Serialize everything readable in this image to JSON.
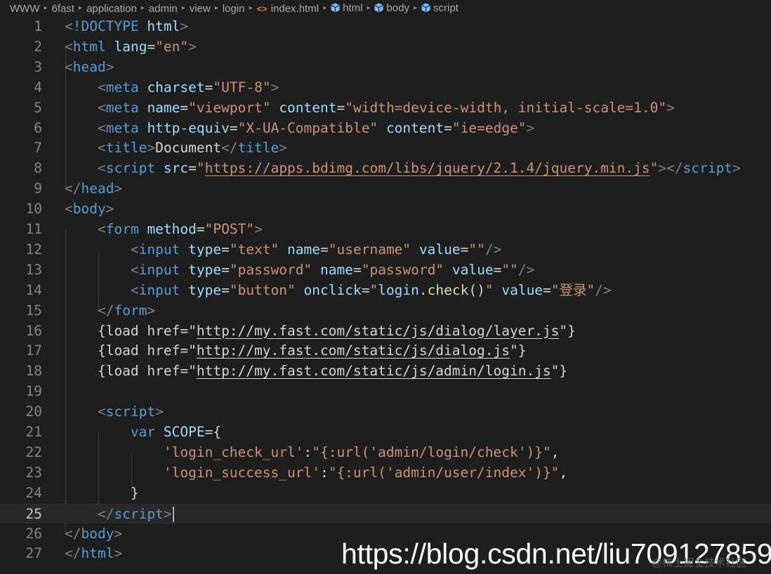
{
  "breadcrumb": {
    "items": [
      "WWW",
      "6fast",
      "application",
      "admin",
      "view",
      "login",
      "index.html",
      "html",
      "body",
      "script"
    ]
  },
  "icons": {
    "separator": "chevron-right-icon",
    "file": "html-file-icon",
    "symbol": "cube-icon"
  },
  "colors": {
    "background": "#1e1e1e",
    "tag": "#569cd6",
    "attribute": "#9cdcfe",
    "string": "#ce9178",
    "text": "#d4d4d4",
    "function": "#dcdcaa",
    "bracket": "#808080"
  },
  "editor": {
    "current_line": 25,
    "lines": [
      {
        "n": "1",
        "tokens": [
          [
            "br",
            "<"
          ],
          [
            "tag",
            "!DOCTYPE"
          ],
          [
            "text",
            " "
          ],
          [
            "attr",
            "html"
          ],
          [
            "br",
            ">"
          ]
        ]
      },
      {
        "n": "2",
        "tokens": [
          [
            "br",
            "<"
          ],
          [
            "tag",
            "html"
          ],
          [
            "text",
            " "
          ],
          [
            "attr",
            "lang"
          ],
          [
            "text",
            "="
          ],
          [
            "str",
            "\"en\""
          ],
          [
            "br",
            ">"
          ]
        ]
      },
      {
        "n": "3",
        "tokens": [
          [
            "br",
            "<"
          ],
          [
            "tag",
            "head"
          ],
          [
            "br",
            ">"
          ]
        ]
      },
      {
        "n": "4",
        "tokens": [
          [
            "text",
            "    "
          ],
          [
            "br",
            "<"
          ],
          [
            "tag",
            "meta"
          ],
          [
            "text",
            " "
          ],
          [
            "attr",
            "charset"
          ],
          [
            "text",
            "="
          ],
          [
            "str",
            "\"UTF-8\""
          ],
          [
            "br",
            ">"
          ]
        ]
      },
      {
        "n": "5",
        "tokens": [
          [
            "text",
            "    "
          ],
          [
            "br",
            "<"
          ],
          [
            "tag",
            "meta"
          ],
          [
            "text",
            " "
          ],
          [
            "attr",
            "name"
          ],
          [
            "text",
            "="
          ],
          [
            "str",
            "\"viewport\""
          ],
          [
            "text",
            " "
          ],
          [
            "attr",
            "content"
          ],
          [
            "text",
            "="
          ],
          [
            "str",
            "\"width=device-width, initial-scale=1.0\""
          ],
          [
            "br",
            ">"
          ]
        ]
      },
      {
        "n": "6",
        "tokens": [
          [
            "text",
            "    "
          ],
          [
            "br",
            "<"
          ],
          [
            "tag",
            "meta"
          ],
          [
            "text",
            " "
          ],
          [
            "attr",
            "http-equiv"
          ],
          [
            "text",
            "="
          ],
          [
            "str",
            "\"X-UA-Compatible\""
          ],
          [
            "text",
            " "
          ],
          [
            "attr",
            "content"
          ],
          [
            "text",
            "="
          ],
          [
            "str",
            "\"ie=edge\""
          ],
          [
            "br",
            ">"
          ]
        ]
      },
      {
        "n": "7",
        "tokens": [
          [
            "text",
            "    "
          ],
          [
            "br",
            "<"
          ],
          [
            "tag",
            "title"
          ],
          [
            "br",
            ">"
          ],
          [
            "text",
            "Document"
          ],
          [
            "br",
            "</"
          ],
          [
            "tag",
            "title"
          ],
          [
            "br",
            ">"
          ]
        ]
      },
      {
        "n": "8",
        "tokens": [
          [
            "text",
            "    "
          ],
          [
            "br",
            "<"
          ],
          [
            "tag",
            "script"
          ],
          [
            "text",
            " "
          ],
          [
            "attr",
            "src"
          ],
          [
            "text",
            "="
          ],
          [
            "str",
            "\""
          ],
          [
            "link",
            "https://apps.bdimg.com/libs/jquery/2.1.4/jquery.min.js"
          ],
          [
            "str",
            "\""
          ],
          [
            "br",
            "></"
          ],
          [
            "tag",
            "script"
          ],
          [
            "br",
            ">"
          ]
        ]
      },
      {
        "n": "9",
        "tokens": [
          [
            "br",
            "</"
          ],
          [
            "tag",
            "head"
          ],
          [
            "br",
            ">"
          ]
        ]
      },
      {
        "n": "10",
        "tokens": [
          [
            "br",
            "<"
          ],
          [
            "tag",
            "body"
          ],
          [
            "br",
            ">"
          ]
        ]
      },
      {
        "n": "11",
        "tokens": [
          [
            "text",
            "    "
          ],
          [
            "br",
            "<"
          ],
          [
            "tag",
            "form"
          ],
          [
            "text",
            " "
          ],
          [
            "attr",
            "method"
          ],
          [
            "text",
            "="
          ],
          [
            "str",
            "\"POST\""
          ],
          [
            "br",
            ">"
          ]
        ]
      },
      {
        "n": "12",
        "tokens": [
          [
            "text",
            "        "
          ],
          [
            "br",
            "<"
          ],
          [
            "tag",
            "input"
          ],
          [
            "text",
            " "
          ],
          [
            "attr",
            "type"
          ],
          [
            "text",
            "="
          ],
          [
            "str",
            "\"text\""
          ],
          [
            "text",
            " "
          ],
          [
            "attr",
            "name"
          ],
          [
            "text",
            "="
          ],
          [
            "str",
            "\"username\""
          ],
          [
            "text",
            " "
          ],
          [
            "attr",
            "value"
          ],
          [
            "text",
            "="
          ],
          [
            "str",
            "\"\""
          ],
          [
            "br",
            "/>"
          ]
        ]
      },
      {
        "n": "13",
        "tokens": [
          [
            "text",
            "        "
          ],
          [
            "br",
            "<"
          ],
          [
            "tag",
            "input"
          ],
          [
            "text",
            " "
          ],
          [
            "attr",
            "type"
          ],
          [
            "text",
            "="
          ],
          [
            "str",
            "\"password\""
          ],
          [
            "text",
            " "
          ],
          [
            "attr",
            "name"
          ],
          [
            "text",
            "="
          ],
          [
            "str",
            "\"password\""
          ],
          [
            "text",
            " "
          ],
          [
            "attr",
            "value"
          ],
          [
            "text",
            "="
          ],
          [
            "str",
            "\"\""
          ],
          [
            "br",
            "/>"
          ]
        ]
      },
      {
        "n": "14",
        "tokens": [
          [
            "text",
            "        "
          ],
          [
            "br",
            "<"
          ],
          [
            "tag",
            "input"
          ],
          [
            "text",
            " "
          ],
          [
            "attr",
            "type"
          ],
          [
            "text",
            "="
          ],
          [
            "str",
            "\"button\""
          ],
          [
            "text",
            " "
          ],
          [
            "attr",
            "onclick"
          ],
          [
            "text",
            "="
          ],
          [
            "str",
            "\""
          ],
          [
            "var",
            "login"
          ],
          [
            "text",
            "."
          ],
          [
            "fn",
            "check"
          ],
          [
            "text",
            "()"
          ],
          [
            "str",
            "\""
          ],
          [
            "text",
            " "
          ],
          [
            "attr",
            "value"
          ],
          [
            "text",
            "="
          ],
          [
            "str",
            "\"登录\""
          ],
          [
            "br",
            "/>"
          ]
        ]
      },
      {
        "n": "15",
        "tokens": [
          [
            "text",
            "    "
          ],
          [
            "br",
            "</"
          ],
          [
            "tag",
            "form"
          ],
          [
            "br",
            ">"
          ]
        ]
      },
      {
        "n": "16",
        "tokens": [
          [
            "text",
            "    {load href=\""
          ],
          [
            "linkw",
            "http://my.fast.com/static/js/dialog/layer.js"
          ],
          [
            "text",
            "\"}"
          ]
        ]
      },
      {
        "n": "17",
        "tokens": [
          [
            "text",
            "    {load href=\""
          ],
          [
            "linkw",
            "http://my.fast.com/static/js/dialog.js"
          ],
          [
            "text",
            "\"}"
          ]
        ]
      },
      {
        "n": "18",
        "tokens": [
          [
            "text",
            "    {load href=\""
          ],
          [
            "linkw",
            "http://my.fast.com/static/js/admin/login.js"
          ],
          [
            "text",
            "\"}"
          ]
        ]
      },
      {
        "n": "19",
        "tokens": []
      },
      {
        "n": "20",
        "tokens": [
          [
            "text",
            "    "
          ],
          [
            "br",
            "<"
          ],
          [
            "tag",
            "script"
          ],
          [
            "br",
            ">"
          ]
        ]
      },
      {
        "n": "21",
        "tokens": [
          [
            "text",
            "        "
          ],
          [
            "kw",
            "var"
          ],
          [
            "text",
            " "
          ],
          [
            "var",
            "SCOPE"
          ],
          [
            "text",
            "={"
          ]
        ]
      },
      {
        "n": "22",
        "tokens": [
          [
            "text",
            "            "
          ],
          [
            "str",
            "'login_check_url'"
          ],
          [
            "text",
            ":"
          ],
          [
            "str",
            "\"{:url('admin/login/check')}\""
          ],
          [
            "text",
            ","
          ]
        ]
      },
      {
        "n": "23",
        "tokens": [
          [
            "text",
            "            "
          ],
          [
            "str",
            "'login_success_url'"
          ],
          [
            "text",
            ":"
          ],
          [
            "str",
            "\"{:url('admin/user/index')}\""
          ],
          [
            "text",
            ","
          ]
        ]
      },
      {
        "n": "24",
        "tokens": [
          [
            "text",
            "        }"
          ]
        ]
      },
      {
        "n": "25",
        "tokens": [
          [
            "text",
            "    "
          ],
          [
            "br",
            "</"
          ],
          [
            "tag",
            "script"
          ],
          [
            "br",
            ">"
          ]
        ]
      },
      {
        "n": "26",
        "tokens": [
          [
            "br",
            "</"
          ],
          [
            "tag",
            "body"
          ],
          [
            "br",
            ">"
          ]
        ]
      },
      {
        "n": "27",
        "tokens": [
          [
            "br",
            "</"
          ],
          [
            "tag",
            "html"
          ],
          [
            "br",
            ">"
          ]
        ]
      }
    ]
  },
  "watermark": {
    "url": "https://blog.csdn.net/liu709127859",
    "secondary": "@稀土掘金技术社区"
  }
}
